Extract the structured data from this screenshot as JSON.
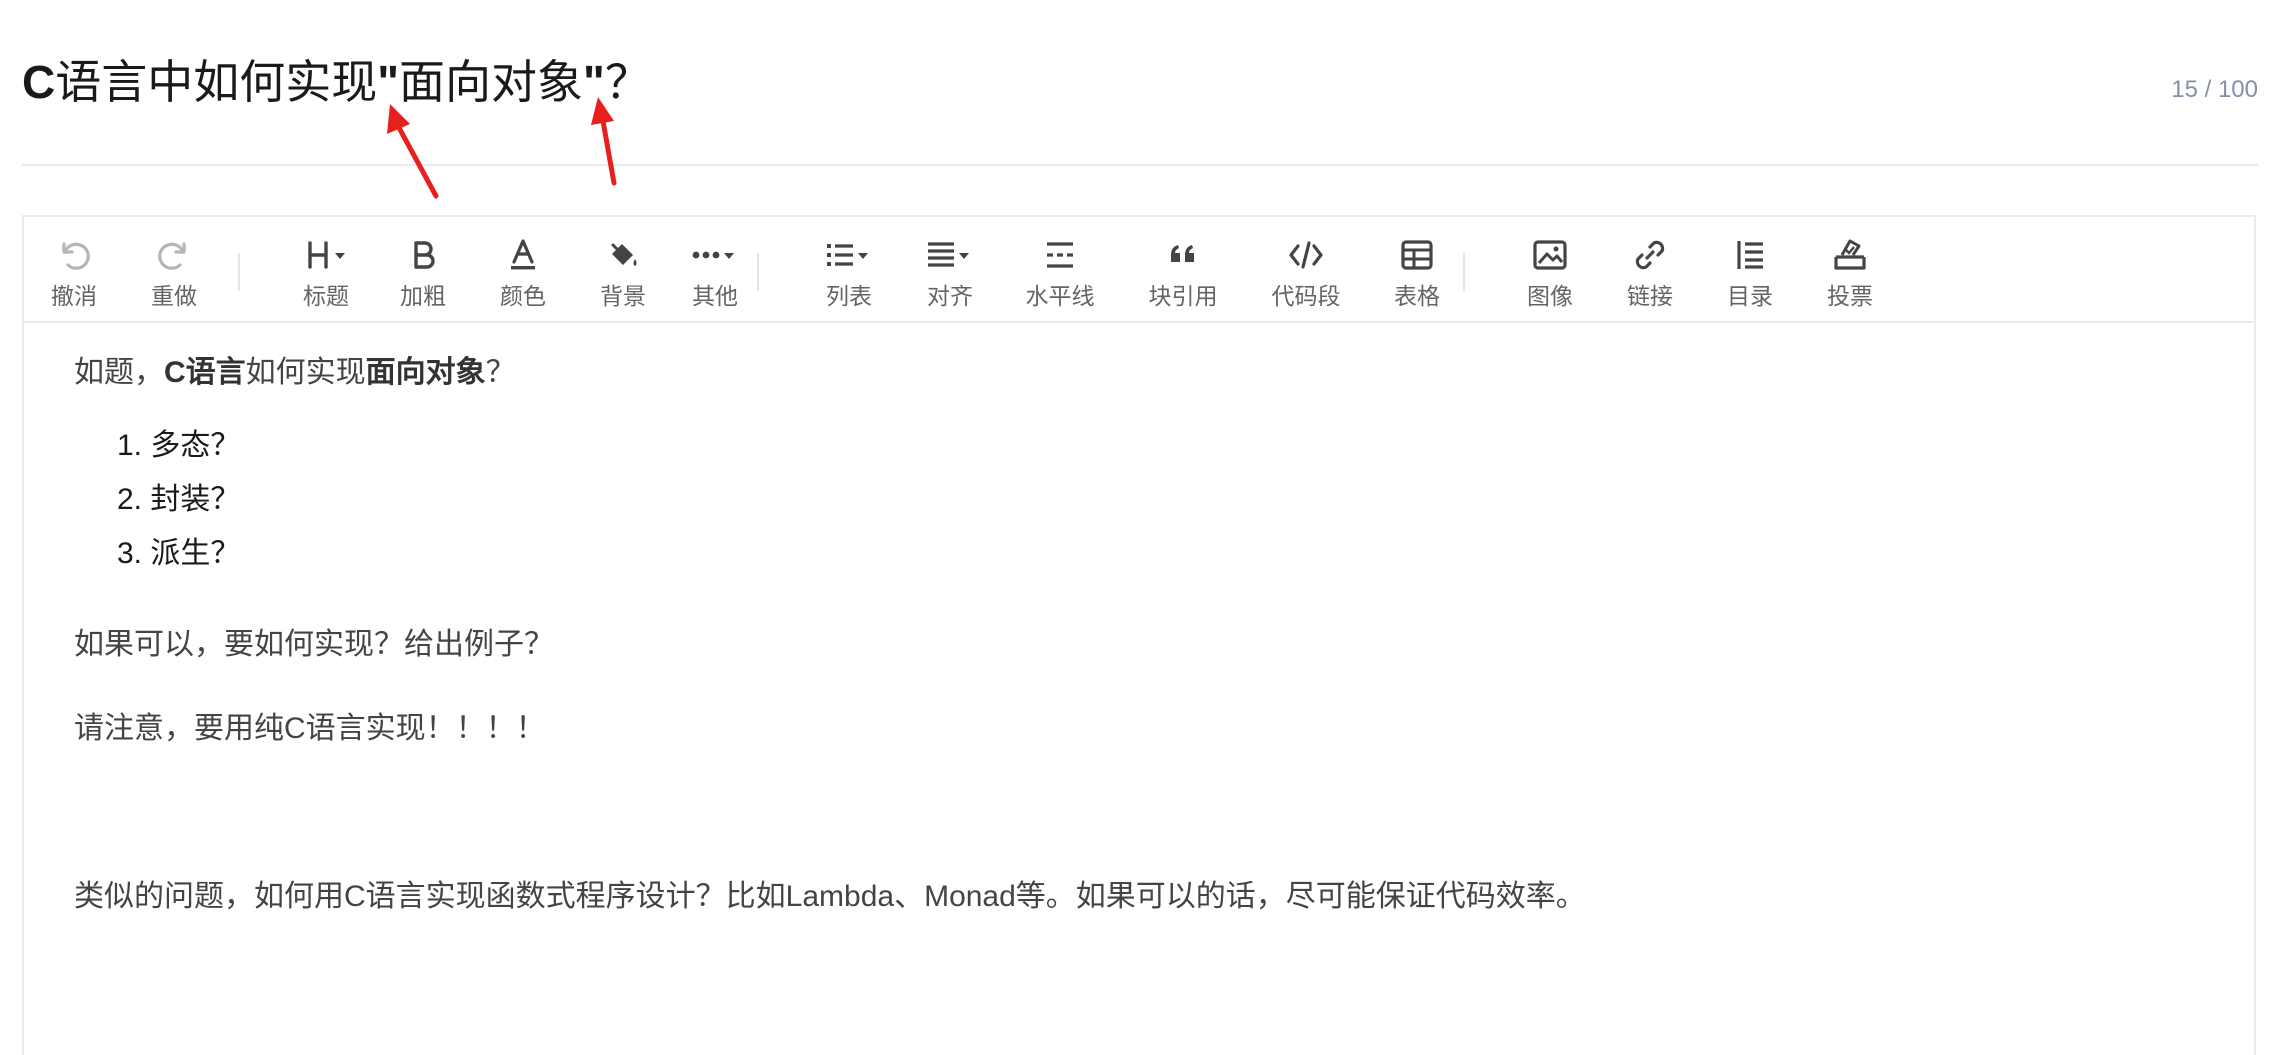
{
  "title": {
    "prefix_bold": "C",
    "part1": "语言中如何实现",
    "quote_open": "\"",
    "part2": "面向对象",
    "quote_close": "\"",
    "part3": "？",
    "counter": "15 / 100"
  },
  "toolbar": {
    "undo": "撤消",
    "redo": "重做",
    "heading": "标题",
    "bold": "加粗",
    "color": "颜色",
    "background": "背景",
    "more": "其他",
    "list": "列表",
    "align": "对齐",
    "hr": "水平线",
    "blockquote": "块引用",
    "codeblock": "代码段",
    "table": "表格",
    "image": "图像",
    "link": "链接",
    "toc": "目录",
    "vote": "投票"
  },
  "body": {
    "p1": {
      "a": "如题，",
      "b_bold": "C语言",
      "c": "如何实现",
      "d_bold": "面向对象",
      "e": "？"
    },
    "list": [
      "多态？",
      "封装？",
      "派生？"
    ],
    "p2": "如果可以，要如何实现？给出例子？",
    "p3": "请注意，要用纯C语言实现！！！！",
    "p4": "类似的问题，如何用C语言实现函数式程序设计？比如Lambda、Monad等。如果可以的话，尽可能保证代码效率。"
  },
  "colors": {
    "annotation_arrow": "#e8201d",
    "icon": "#444444",
    "icon_disabled": "#b5b5b5",
    "muted_text": "#8590a6"
  }
}
